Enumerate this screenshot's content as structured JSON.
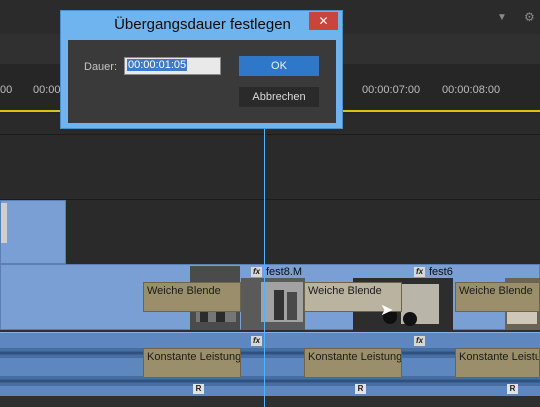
{
  "dialog": {
    "title": "Übergangsdauer festlegen",
    "close_symbol": "✕",
    "field_label": "Dauer:",
    "field_value": "00:00:01:05",
    "ok_label": "OK",
    "cancel_label": "Abbrechen"
  },
  "ruler": {
    "timecodes": [
      "00",
      "00:00",
      "00:00:07:00",
      "00:00:08:00"
    ]
  },
  "clips": {
    "video_title_1": "fest8.M",
    "video_title_2": "fest6",
    "transition_label": "Weiche Blende",
    "audio_transition_label": "Konstante Leistung",
    "fx_badge": "fx",
    "r_badge": "R"
  },
  "colors": {
    "accent_blue": "#2f77c8",
    "dialog_frame": "#6fb4ee",
    "playhead": "#4fb4ff",
    "timeline_yellow": "#d8c21a",
    "video_clip": "#7a9fd4",
    "transition": "#9a8f6a"
  }
}
